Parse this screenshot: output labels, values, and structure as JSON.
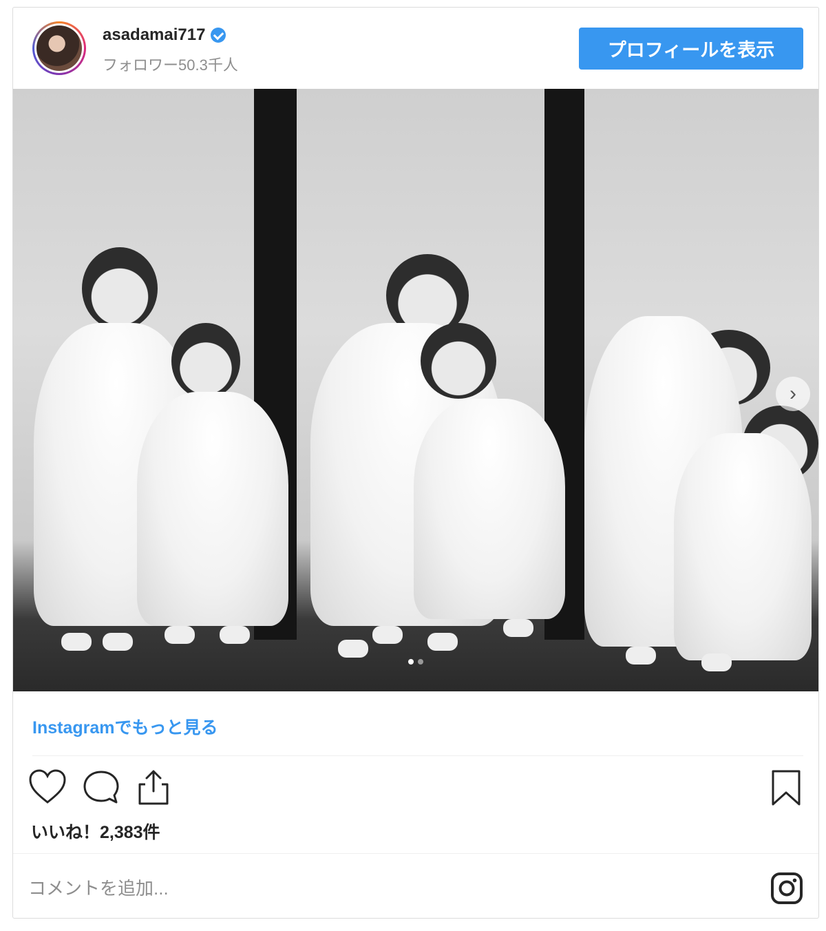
{
  "header": {
    "username": "asadamai717",
    "followers": "フォロワー50.3千人",
    "profile_button": "プロフィールを表示"
  },
  "post": {
    "more_link": "Instagramでもっと見る",
    "likes": "いいね！2,383件",
    "comment_placeholder": "コメントを追加..."
  },
  "carousel": {
    "page_count": 2,
    "active_page": 1
  },
  "colors": {
    "accent": "#3897f0",
    "text": "#262626",
    "muted": "#8e8e8e"
  },
  "icons": {
    "verified": "verified-badge-icon",
    "like": "heart-icon",
    "comment": "comment-icon",
    "share": "share-icon",
    "save": "bookmark-icon",
    "instagram": "instagram-logo-icon",
    "next": "chevron-right-icon"
  }
}
